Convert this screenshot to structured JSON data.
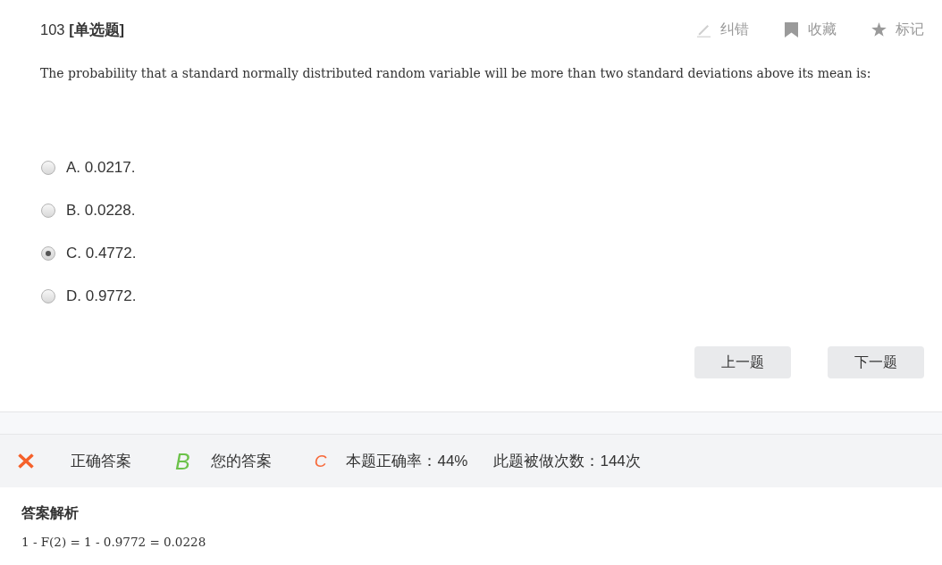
{
  "question": {
    "heading": "103 **[单选题]**",
    "text": "The probability that a standard normally distributed random variable will be more than two standard deviations above its mean is:"
  },
  "toolbar": [
    {
      "kind": "correction",
      "label": "纠错"
    },
    {
      "kind": "favorite",
      "label": "收藏"
    },
    {
      "kind": "mark",
      "label": "标记"
    }
  ],
  "options": [
    {
      "label": "A. 0.0217.",
      "selected": false
    },
    {
      "label": "B. 0.0228.",
      "selected": false
    },
    {
      "label": "C. 0.4772.",
      "selected": true
    },
    {
      "label": "D. 0.9772.",
      "selected": false
    }
  ],
  "nav_buttons": [
    "上一题",
    "下一题"
  ],
  "result": {
    "correct": false,
    "correct_answer": {
      "label": "正确答案",
      "value": "B"
    },
    "your_answer": {
      "label": "您的答案",
      "value": "C"
    },
    "accuracy": "本题正确率：44%",
    "attempts": "此题被做次数：144次"
  },
  "explanation": {
    "title": "答案解析",
    "text": "1 - F(2) = 1 - 0.9772 = 0.0228"
  }
}
